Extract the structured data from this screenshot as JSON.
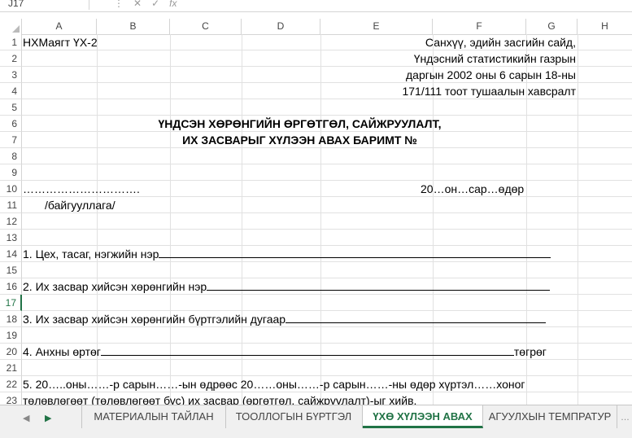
{
  "formula_bar": {
    "name_box": "J17",
    "fx": "fx"
  },
  "columns": [
    "A",
    "B",
    "C",
    "D",
    "E",
    "F",
    "G",
    "H"
  ],
  "rows": [
    "1",
    "2",
    "3",
    "4",
    "5",
    "6",
    "7",
    "8",
    "9",
    "10",
    "11",
    "12",
    "13",
    "14",
    "15",
    "16",
    "17",
    "18",
    "19",
    "20",
    "21",
    "22",
    "23"
  ],
  "active_row": "17",
  "cells": {
    "r1_a": "НХМаягт ҮХ-2",
    "r1_f": "Санхүү, эдийн засгийн сайд,",
    "r2_f": "Үндэсний статистикийн газрын",
    "r3_f": "даргын 2002 оны 6 сарын 18-ны",
    "r4_f": "171/111 тоот тушаалын хавсралт",
    "r6_title": "ҮНДСЭН ХӨРӨНГИЙН ӨРГӨТГӨЛ, САЙЖРУУЛАЛТ,",
    "r7_title": "ИХ ЗАСВАРЫГ ХҮЛЭЭН АВАХ БАРИМТ №",
    "r10_a": "………………………….",
    "r10_e": "20…он…сар…өдөр",
    "r11_a": "/байгууллага/",
    "r14": "1. Цех, тасаг, нэгжийн нэр",
    "r16": "2. Их засвар хийсэн хөрөнгийн нэр",
    "r18": "3. Их засвар хийсэн хөрөнгийн бүртгэлийн дугаар",
    "r20": "4. Анхны өртөг",
    "r20_unit": "төгрөг",
    "r22": "5. 20…..оны……-р сарын……-ын өдрөөс 20……оны……-р сарын……-ны өдөр хүртэл……хоног",
    "r23": "төлөвлөгөөт (төлөвлөгөөт бус) их засвар (өргөтгөл, сайжруулалт)-ыг хийв."
  },
  "sheet_tabs": [
    {
      "label": "МАТЕРИАЛЫН ТАЙЛАН",
      "active": false
    },
    {
      "label": "ТООЛЛОГЫН БҮРТГЭЛ",
      "active": false
    },
    {
      "label": "ҮХӨ ХҮЛЭЭН АВАХ",
      "active": true
    },
    {
      "label": "АГУУЛХЫН ТЕМПРАТУР",
      "active": false
    }
  ],
  "colors": {
    "accent": "#217346",
    "grid": "#e1e1e1",
    "header_border": "#d4d4d4"
  }
}
